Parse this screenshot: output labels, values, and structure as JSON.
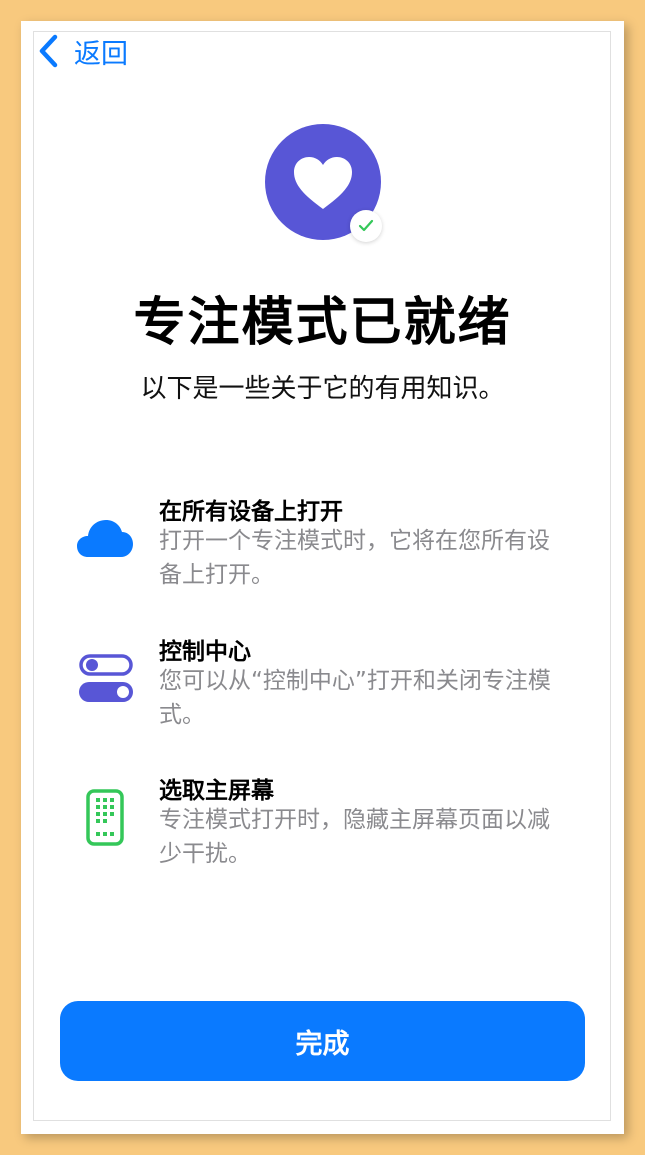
{
  "nav": {
    "back_label": "返回"
  },
  "header": {
    "title": "专注模式已就绪",
    "subtitle": "以下是一些关于它的有用知识。"
  },
  "features": [
    {
      "icon": "cloud-icon",
      "title": "在所有设备上打开",
      "description": "打开一个专注模式时，它将在您所有设备上打开。"
    },
    {
      "icon": "toggle-switches-icon",
      "title": "控制中心",
      "description": "您可以从“控制中心”打开和关闭专注模式。"
    },
    {
      "icon": "home-screen-icon",
      "title": "选取主屏幕",
      "description": "专注模式打开时，隐藏主屏幕页面以减少干扰。"
    }
  ],
  "footer": {
    "done_label": "完成"
  },
  "colors": {
    "accent": "#0a7aff",
    "hero": "#5856d6",
    "check": "#34c759",
    "home_screen": "#34c759",
    "toggle": "#5856d6",
    "secondary_text": "#8a8a8e",
    "background": "#f8c97e"
  }
}
